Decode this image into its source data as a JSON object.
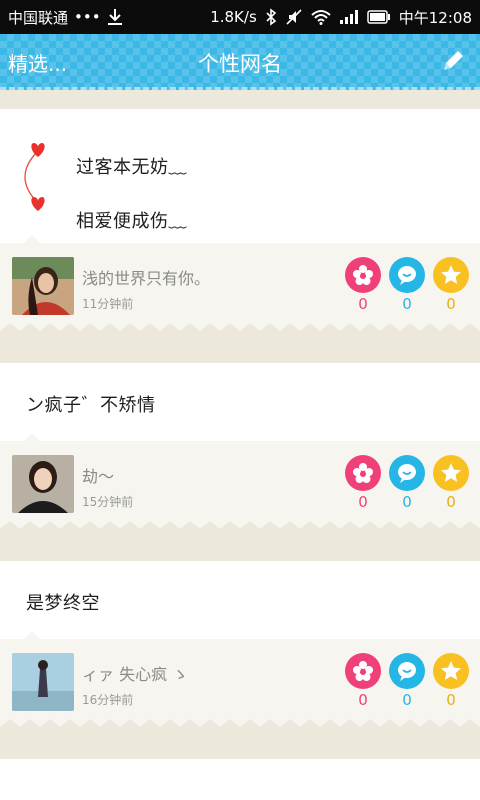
{
  "status_bar": {
    "carrier": "中国联通",
    "dots": "•••",
    "speed": "1.8K/s",
    "time": "中午12:08"
  },
  "header": {
    "back_label": "精选...",
    "title": "个性网名",
    "edit_icon": "pencil-icon"
  },
  "posts": [
    {
      "lines": [
        "过客本无妨﹏",
        "相爱便成伤﹏"
      ],
      "user": "浅的世界只有你。",
      "time": "11分钟前",
      "likes": "0",
      "comments": "0",
      "favorites": "0"
    },
    {
      "lines": [
        "ン疯子゛不矫情"
      ],
      "user": "劫～",
      "time": "15分钟前",
      "likes": "0",
      "comments": "0",
      "favorites": "0"
    },
    {
      "lines": [
        "是梦终空"
      ],
      "user": "ィァ 失心疯 ゝ",
      "time": "16分钟前",
      "likes": "0",
      "comments": "0",
      "favorites": "0"
    }
  ],
  "colors": {
    "title_bar": "#3cb8e6",
    "like": "#f0407a",
    "comment": "#26b6e6",
    "favorite": "#f8c020"
  }
}
